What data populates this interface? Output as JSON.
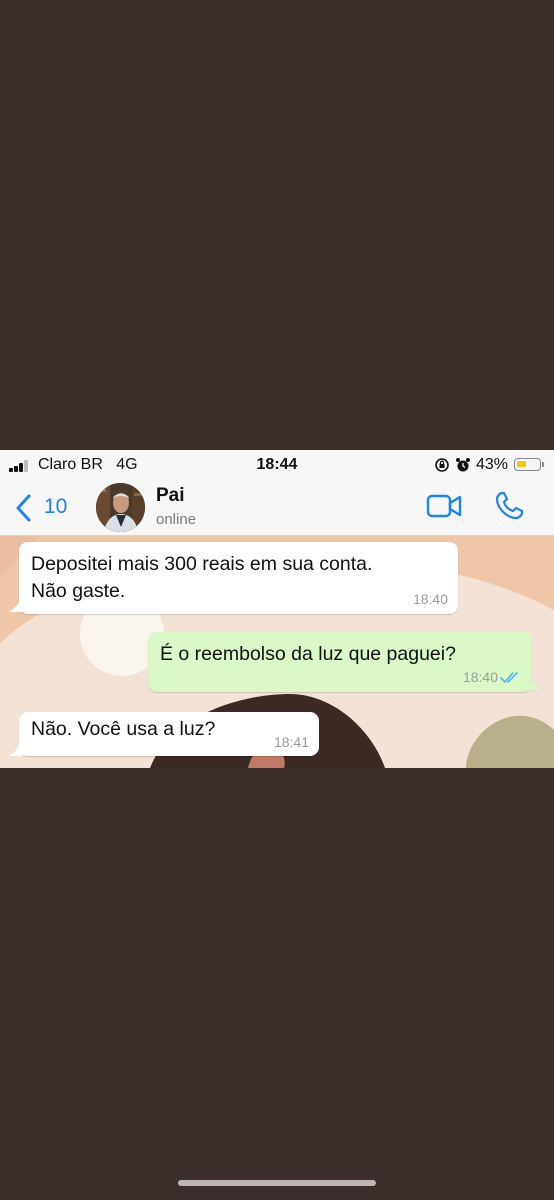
{
  "status_bar": {
    "carrier": "Claro BR",
    "network": "4G",
    "time": "18:44",
    "battery_percent": "43%",
    "battery_level": 0.43,
    "icons": [
      "signal-icon",
      "orientation-lock-icon",
      "alarm-icon",
      "battery-icon"
    ]
  },
  "header": {
    "back_count": "10",
    "contact_name": "Pai",
    "contact_status": "online",
    "icons": [
      "back-chevron-icon",
      "video-call-icon",
      "phone-call-icon"
    ]
  },
  "messages": [
    {
      "direction": "incoming",
      "text": "Depositei mais 300 reais em sua conta.\nNão gaste.",
      "time": "18:40"
    },
    {
      "direction": "outgoing",
      "text": "É o reembolso da luz que paguei?",
      "time": "18:40",
      "status": "read-double-check-icon"
    },
    {
      "direction": "incoming",
      "text": "Não. Você usa a luz?",
      "time": "18:41"
    }
  ],
  "colors": {
    "page_background": "#3c2e2b",
    "accent_blue": "#1c84f2",
    "outgoing_bubble": "#dcf8c6",
    "incoming_bubble": "#ffffff",
    "read_ticks": "#4fb6ec",
    "battery_fill": "#f0c419"
  }
}
